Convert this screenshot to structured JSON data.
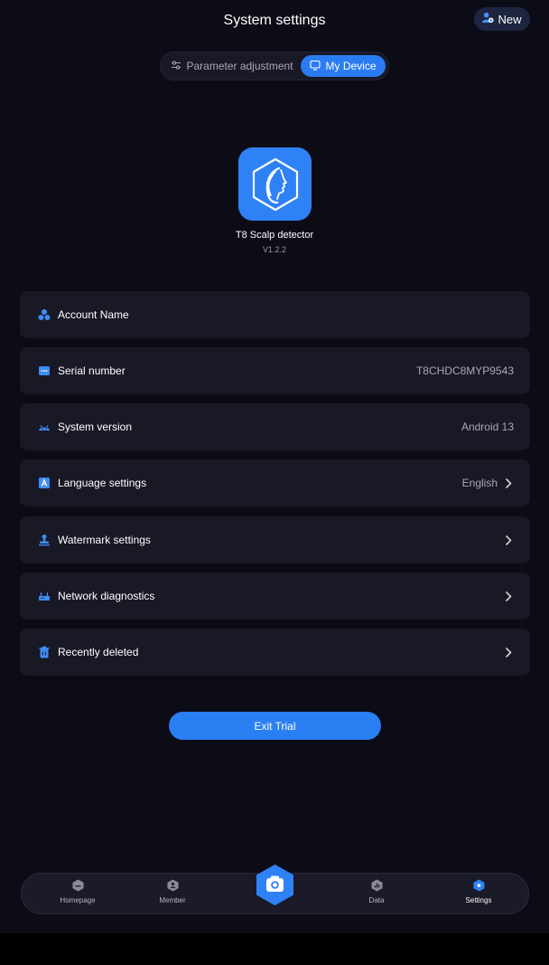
{
  "header": {
    "title": "System settings",
    "new_label": "New"
  },
  "tabs": [
    {
      "label": "Parameter adjustment",
      "active": false,
      "icon": "sliders-icon"
    },
    {
      "label": "My Device",
      "active": true,
      "icon": "monitor-icon"
    }
  ],
  "app": {
    "name": "T8  Scalp detector",
    "version": "V1.2.2",
    "icon": "face-profile-logo"
  },
  "rows": [
    {
      "label": "Account Name",
      "value": "",
      "icon": "account-icon",
      "chevron": false
    },
    {
      "label": "Serial number",
      "value": "T8CHDC8MYP9543",
      "icon": "serial-icon",
      "chevron": false
    },
    {
      "label": "System version",
      "value": "Android 13",
      "icon": "android-icon",
      "chevron": false
    },
    {
      "label": "Language settings",
      "value": "English",
      "icon": "language-icon",
      "chevron": true
    },
    {
      "label": "Watermark settings",
      "value": "",
      "icon": "stamp-icon",
      "chevron": true
    },
    {
      "label": "Network diagnostics",
      "value": "",
      "icon": "router-icon",
      "chevron": true
    },
    {
      "label": "Recently deleted",
      "value": "",
      "icon": "trash-icon",
      "chevron": true
    }
  ],
  "exit_label": "Exit Trial",
  "nav": {
    "items": [
      {
        "label": "Homepage",
        "icon": "home-hex-icon",
        "active": false
      },
      {
        "label": "Member",
        "icon": "member-hex-icon",
        "active": false
      },
      {
        "label": "Data",
        "icon": "data-hex-icon",
        "active": false
      },
      {
        "label": "Settings",
        "icon": "settings-hex-icon",
        "active": true
      }
    ],
    "camera_icon": "camera-icon"
  },
  "colors": {
    "accent": "#2b7cf3",
    "background": "#0c0c17",
    "card": "#191926"
  }
}
